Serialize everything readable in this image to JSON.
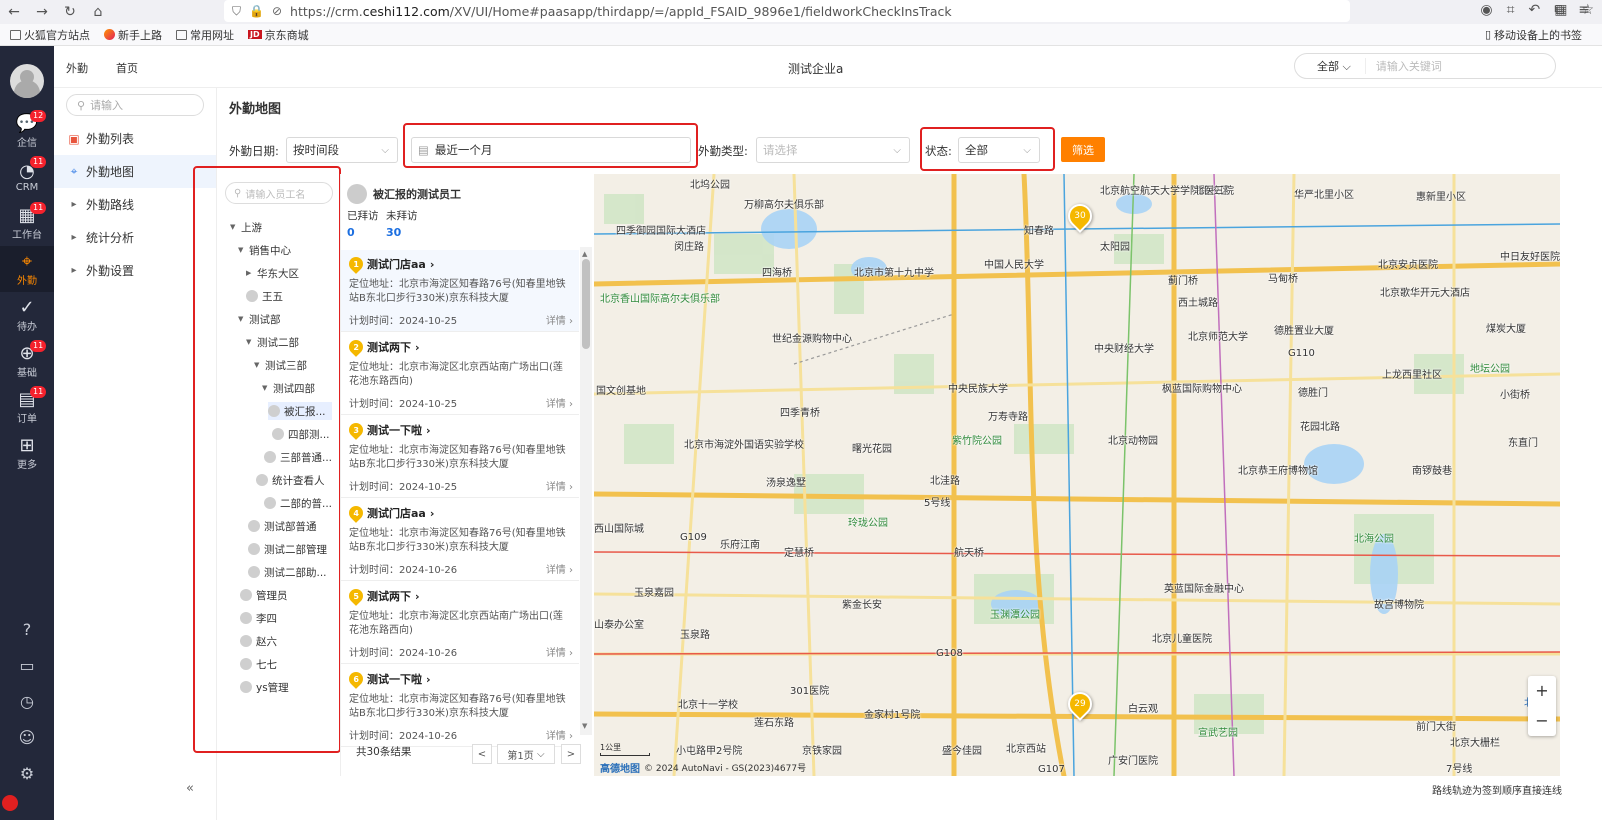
{
  "browser": {
    "url_prefix": "https://crm.",
    "url_domain": "ceshi112.com",
    "url_suffix": "/XV/UI/Home#paasapp/thirdapp/=/appId_FSAID_9896e1/fieldworkCheckInsTrack",
    "bookmarks": [
      "火狐官方站点",
      "新手上路",
      "常用网址",
      "京东商城"
    ],
    "jd_badge": "JD",
    "mobile_bookmarks": "移动设备上的书签"
  },
  "side_nav": {
    "items": [
      {
        "label": "企信",
        "icon": "💬",
        "badge": "12"
      },
      {
        "label": "CRM",
        "icon": "◔",
        "badge": "11"
      },
      {
        "label": "工作台",
        "icon": "▦",
        "badge": "11"
      },
      {
        "label": "外勤",
        "icon": "⌖",
        "badge": ""
      },
      {
        "label": "待办",
        "icon": "✓",
        "badge": ""
      },
      {
        "label": "基础",
        "icon": "⊕",
        "badge": "11"
      },
      {
        "label": "订单",
        "icon": "▤",
        "badge": "11"
      },
      {
        "label": "更多",
        "icon": "⊞",
        "badge": ""
      }
    ],
    "bottom_icons": [
      "?",
      "▭",
      "◷",
      "☺",
      "⚙"
    ]
  },
  "header": {
    "crumb_1": "外勤",
    "crumb_2": "首页",
    "title": "测试企业a",
    "search_scope": "全部",
    "search_placeholder": "请输入关键词"
  },
  "left_menu": {
    "search_placeholder": "请输入",
    "items": [
      "外勤列表",
      "外勤地图",
      "外勤路线",
      "统计分析",
      "外勤设置"
    ],
    "collapse": "«"
  },
  "page": {
    "title": "外勤地图",
    "filters": {
      "date_label": "外勤日期:",
      "date_mode": "按时间段",
      "date_range": "最近一个月",
      "type_label": "外勤类型:",
      "type_placeholder": "请选择",
      "status_label": "状态:",
      "status_value": "全部",
      "filter_button": "筛选"
    }
  },
  "tree": {
    "search_placeholder": "请输入员工名",
    "nodes": [
      {
        "label": "上游",
        "kind": "folder"
      },
      {
        "label": "销售中心",
        "kind": "folder"
      },
      {
        "label": "华东大区",
        "kind": "collapsed"
      },
      {
        "label": "王五",
        "kind": "person"
      },
      {
        "label": "测试部",
        "kind": "folder"
      },
      {
        "label": "测试二部",
        "kind": "folder"
      },
      {
        "label": "测试三部",
        "kind": "folder"
      },
      {
        "label": "测试四部",
        "kind": "folder"
      },
      {
        "label": "被汇报...",
        "kind": "person",
        "selected": true
      },
      {
        "label": "四部测...",
        "kind": "person"
      },
      {
        "label": "三部普通...",
        "kind": "person"
      },
      {
        "label": "统计查看人",
        "kind": "person"
      },
      {
        "label": "二部的普...",
        "kind": "person"
      },
      {
        "label": "测试部普通",
        "kind": "person"
      },
      {
        "label": "测试二部管理",
        "kind": "person"
      },
      {
        "label": "测试二部助...",
        "kind": "person"
      },
      {
        "label": "管理员",
        "kind": "person"
      },
      {
        "label": "李四",
        "kind": "person"
      },
      {
        "label": "赵六",
        "kind": "person"
      },
      {
        "label": "七七",
        "kind": "person"
      },
      {
        "label": "ys管理",
        "kind": "person"
      }
    ]
  },
  "visits": {
    "employee": "被汇报的测试员工",
    "visited_label": "已拜访",
    "unvisited_label": "未拜访",
    "visited_count": "0",
    "unvisited_count": "30",
    "cards": [
      {
        "no": "1",
        "name": "测试门店aa",
        "addr": "定位地址：北京市海淀区知春路76号(知春里地铁站B东北口步行330米)京东科技大厦",
        "time": "计划时间：2024-10-25",
        "detail": "详情"
      },
      {
        "no": "2",
        "name": "测试两下",
        "addr": "定位地址：北京市海淀区北京西站南广场出口(莲花池东路西向)",
        "time": "计划时间：2024-10-25",
        "detail": "详情"
      },
      {
        "no": "3",
        "name": "测试一下啦",
        "addr": "定位地址：北京市海淀区知春路76号(知春里地铁站B东北口步行330米)京东科技大厦",
        "time": "计划时间：2024-10-25",
        "detail": "详情"
      },
      {
        "no": "4",
        "name": "测试门店aa",
        "addr": "定位地址：北京市海淀区知春路76号(知春里地铁站B东北口步行330米)京东科技大厦",
        "time": "计划时间：2024-10-26",
        "detail": "详情"
      },
      {
        "no": "5",
        "name": "测试两下",
        "addr": "定位地址：北京市海淀区北京西站南广场出口(莲花池东路西向)",
        "time": "计划时间：2024-10-26",
        "detail": "详情"
      },
      {
        "no": "6",
        "name": "测试一下啦",
        "addr": "定位地址：北京市海淀区知春路76号(知春里地铁站B东北口步行330米)京东科技大厦",
        "time": "计划时间：2024-10-26",
        "detail": "详情"
      }
    ],
    "total": "共30条结果",
    "page": "第1页"
  },
  "map": {
    "labels": [
      {
        "t": "北坞公园",
        "c": ""
      },
      {
        "t": "四季御园国际大酒店",
        "c": ""
      },
      {
        "t": "闵庄路",
        "c": ""
      },
      {
        "t": "万柳高尔夫俱乐部",
        "c": ""
      },
      {
        "t": "北京航空航天大学学院路校区",
        "c": ""
      },
      {
        "t": "北医三院",
        "c": ""
      },
      {
        "t": "华严北里小区",
        "c": ""
      },
      {
        "t": "惠新里小区",
        "c": ""
      },
      {
        "t": "知春路",
        "c": ""
      },
      {
        "t": "太阳园",
        "c": ""
      },
      {
        "t": "中国人民大学",
        "c": ""
      },
      {
        "t": "四海桥",
        "c": ""
      },
      {
        "t": "北京市第十九中学",
        "c": ""
      },
      {
        "t": "北京安贞医院",
        "c": ""
      },
      {
        "t": "中日友好医院",
        "c": ""
      },
      {
        "t": "蓟门桥",
        "c": ""
      },
      {
        "t": "马甸桥",
        "c": ""
      },
      {
        "t": "北京歌华开元大酒店",
        "c": ""
      },
      {
        "t": "北京香山国际高尔夫俱乐部",
        "c": "green"
      },
      {
        "t": "世纪金源购物中心",
        "c": ""
      },
      {
        "t": "北京师范大学",
        "c": ""
      },
      {
        "t": "德胜置业大厦",
        "c": ""
      },
      {
        "t": "煤炭大厦",
        "c": ""
      },
      {
        "t": "中央财经大学",
        "c": ""
      },
      {
        "t": "西土城路",
        "c": ""
      },
      {
        "t": "G110",
        "c": ""
      },
      {
        "t": "地坛公园",
        "c": "green"
      },
      {
        "t": "上龙西里社区",
        "c": ""
      },
      {
        "t": "国文创基地",
        "c": ""
      },
      {
        "t": "中央民族大学",
        "c": ""
      },
      {
        "t": "枫蓝国际购物中心",
        "c": ""
      },
      {
        "t": "德胜门",
        "c": ""
      },
      {
        "t": "小街桥",
        "c": ""
      },
      {
        "t": "四季青桥",
        "c": ""
      },
      {
        "t": "万寿寺路",
        "c": ""
      },
      {
        "t": "花园北路",
        "c": ""
      },
      {
        "t": "北京市海淀外国语实验学校",
        "c": ""
      },
      {
        "t": "曙光花园",
        "c": ""
      },
      {
        "t": "紫竹院公园",
        "c": "green"
      },
      {
        "t": "北京动物园",
        "c": ""
      },
      {
        "t": "东直门",
        "c": ""
      },
      {
        "t": "北洼路",
        "c": ""
      },
      {
        "t": "汤泉逸墅",
        "c": ""
      },
      {
        "t": "北京恭王府博物馆",
        "c": ""
      },
      {
        "t": "南锣鼓巷",
        "c": ""
      },
      {
        "t": "5号线",
        "c": ""
      },
      {
        "t": "西山国际城",
        "c": ""
      },
      {
        "t": "玲珑公园",
        "c": "green"
      },
      {
        "t": "G109",
        "c": ""
      },
      {
        "t": "乐府江南",
        "c": ""
      },
      {
        "t": "定慧桥",
        "c": ""
      },
      {
        "t": "航天桥",
        "c": ""
      },
      {
        "t": "北海公园",
        "c": "green"
      },
      {
        "t": "玉泉嘉园",
        "c": ""
      },
      {
        "t": "英蓝国际金融中心",
        "c": ""
      },
      {
        "t": "紫金长安",
        "c": ""
      },
      {
        "t": "玉渊潭公园",
        "c": "green"
      },
      {
        "t": "故宫博物院",
        "c": ""
      },
      {
        "t": "山泰办公室",
        "c": ""
      },
      {
        "t": "玉泉路",
        "c": ""
      },
      {
        "t": "北京儿童医院",
        "c": ""
      },
      {
        "t": "G108",
        "c": ""
      },
      {
        "t": "301医院",
        "c": ""
      },
      {
        "t": "北京十一学校",
        "c": ""
      },
      {
        "t": "金家村1号院",
        "c": ""
      },
      {
        "t": "白云观",
        "c": ""
      },
      {
        "t": "莲石东路",
        "c": ""
      },
      {
        "t": "前门大街",
        "c": ""
      },
      {
        "t": "小屯路甲2号院",
        "c": ""
      },
      {
        "t": "京铁家园",
        "c": ""
      },
      {
        "t": "盛今佳园",
        "c": ""
      },
      {
        "t": "北京西站",
        "c": ""
      },
      {
        "t": "广安门医院",
        "c": ""
      },
      {
        "t": "宣武艺园",
        "c": "green"
      },
      {
        "t": "北京大栅栏",
        "c": ""
      },
      {
        "t": "7号线",
        "c": ""
      },
      {
        "t": "G107",
        "c": ""
      },
      {
        "t": "北京",
        "c": "blue"
      }
    ],
    "marker_a": "30",
    "marker_b": "29",
    "zoom_in": "+",
    "zoom_out": "−",
    "scale": "1公里",
    "logo": "高德地图",
    "copyright": "© 2024 AutoNavi - GS(2023)4677号"
  },
  "footer_note": "路线轨迹为签到顺序直接连线"
}
